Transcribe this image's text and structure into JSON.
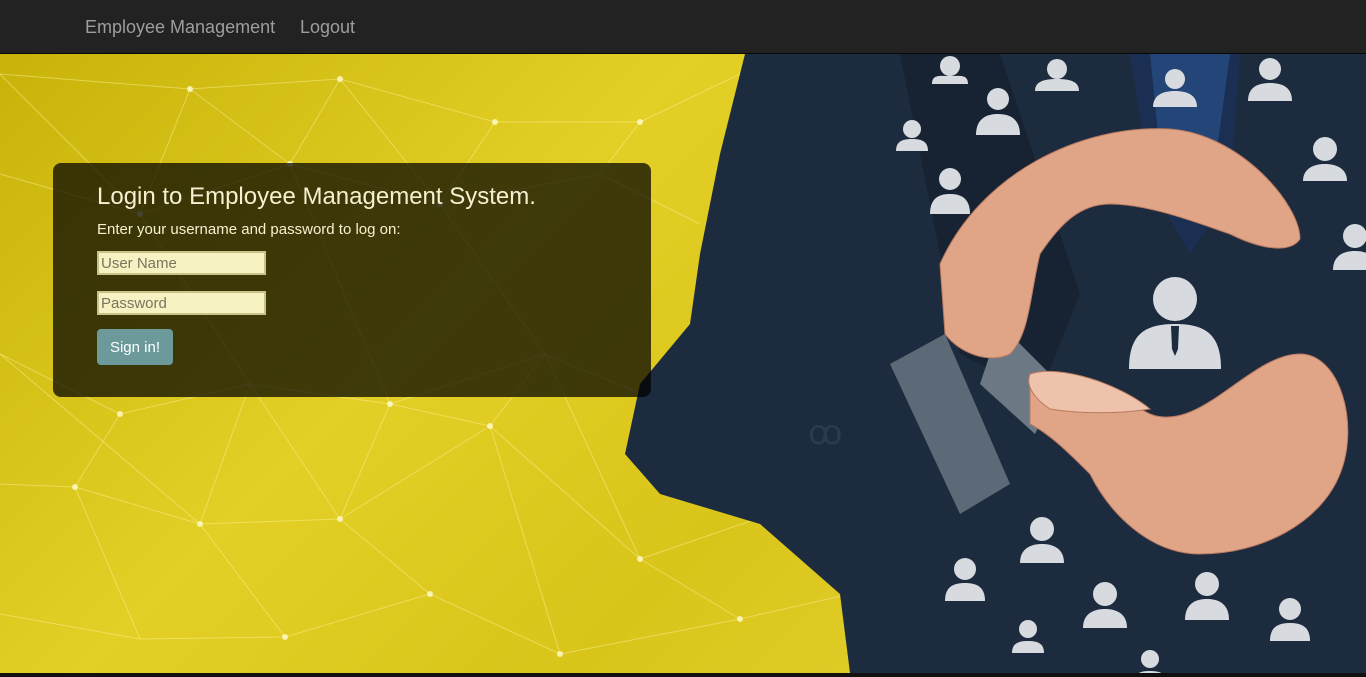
{
  "nav": {
    "brand": "Employee Management",
    "logout": "Logout"
  },
  "login": {
    "title": "Login to Employee Management System.",
    "subtitle": "Enter your username and password to log on:",
    "username_placeholder": "User Name",
    "password_placeholder": "Password",
    "signin_label": "Sign in!"
  },
  "colors": {
    "navbar": "#222222",
    "nav_text": "#9d9d9d",
    "background_yellow": "#e3cf25",
    "suit_navy": "#1d2b3f",
    "signin_button": "#6c9a9a"
  }
}
